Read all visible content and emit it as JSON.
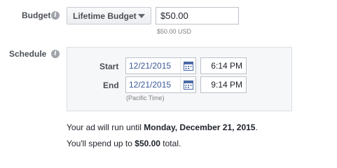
{
  "budget": {
    "label": "Budget",
    "info_icon": "info-icon",
    "type_selected": "Lifetime Budget",
    "amount_value": "$50.00",
    "amount_helper": "$50.00 USD"
  },
  "schedule": {
    "label": "Schedule",
    "info_icon": "info-icon",
    "start": {
      "label": "Start",
      "date": "12/21/2015",
      "time": "6:14 PM"
    },
    "end": {
      "label": "End",
      "date": "12/21/2015",
      "time": "9:14 PM"
    },
    "timezone_note": "(Pacific Time)"
  },
  "summary": {
    "run_prefix": "Your ad will run until ",
    "run_date": "Monday, December 21, 2015",
    "run_suffix": ".",
    "spend_prefix": "You'll spend up to ",
    "spend_amount": "$50.00",
    "spend_suffix": " total."
  },
  "icons": {
    "calendar": "calendar-icon",
    "dropdown": "chevron-down-icon"
  },
  "colors": {
    "link_text": "#3b5998",
    "label_text": "#4b4f56",
    "panel_bg": "#f6f7f9"
  }
}
